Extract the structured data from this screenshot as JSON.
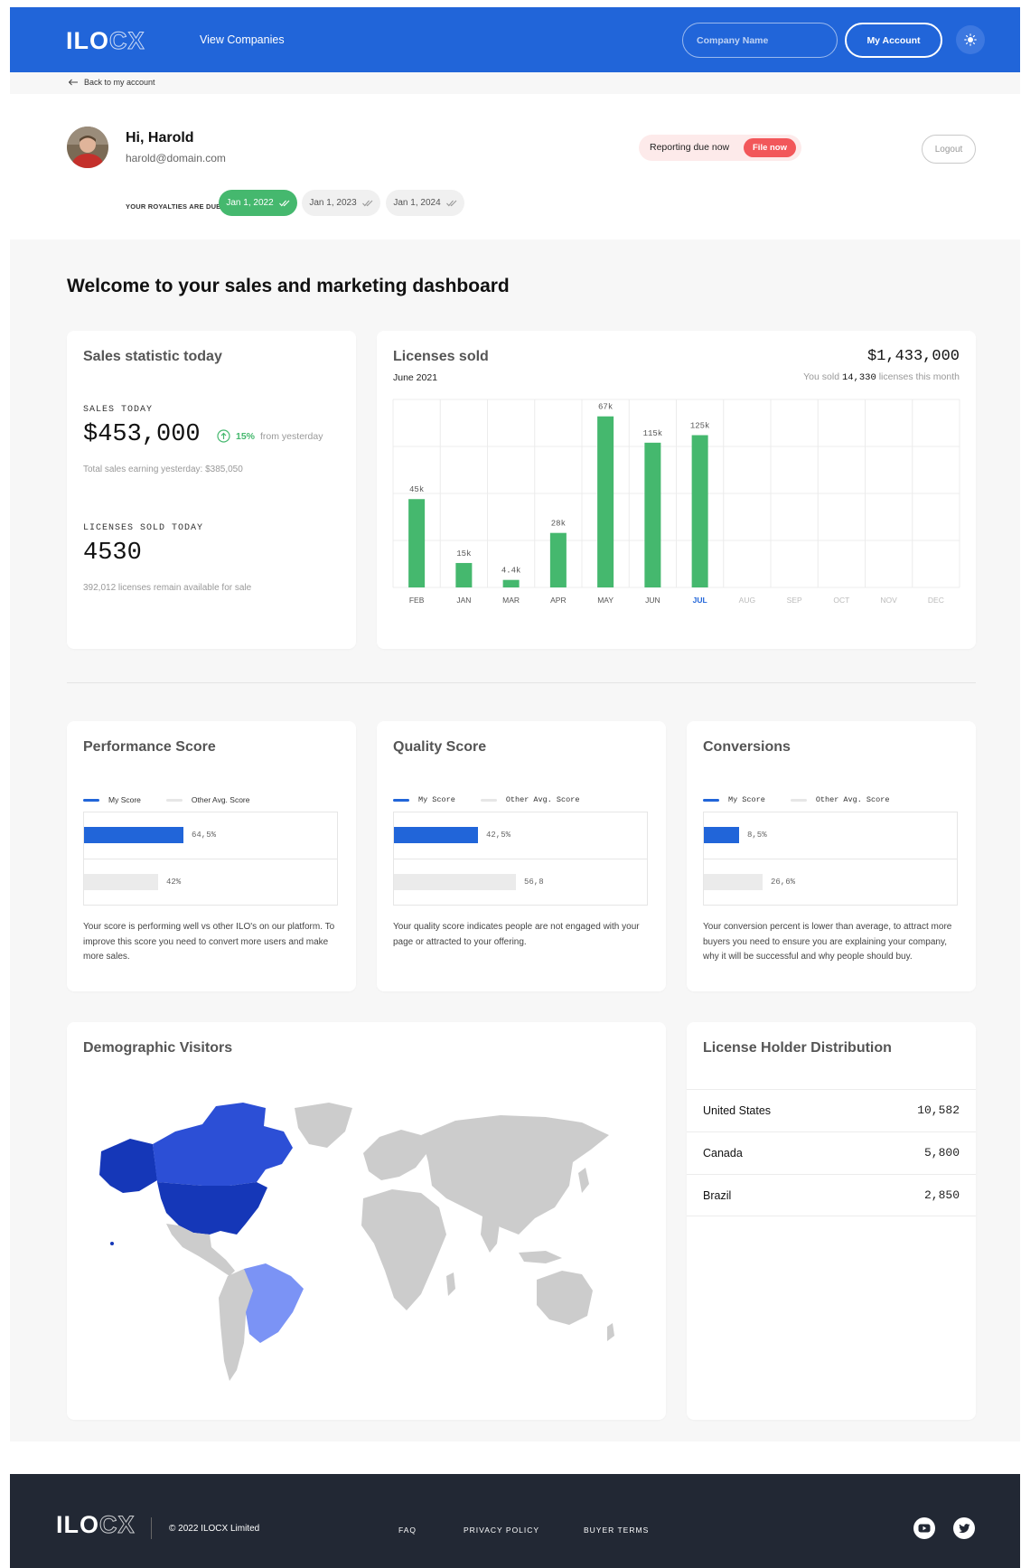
{
  "header": {
    "logo_main": "ILO",
    "logo_outline": "CX",
    "nav_view_companies": "View Companies",
    "company_placeholder": "Company Name",
    "my_account": "My Account"
  },
  "back_link": "Back to my account",
  "profile": {
    "greeting": "Hi, Harold",
    "email": "harold@domain.com"
  },
  "reporting": {
    "text": "Reporting due now",
    "file_button": "File now",
    "logout": "Logout"
  },
  "royalties": {
    "label": "YOUR ROYALTIES ARE DUE",
    "dates": [
      {
        "label": "Jan 1, 2022",
        "active": true
      },
      {
        "label": "Jan 1, 2023",
        "active": false
      },
      {
        "label": "Jan 1, 2024",
        "active": false
      }
    ]
  },
  "page_title": "Welcome to your sales and marketing dashboard",
  "sales_card": {
    "title": "Sales statistic today",
    "sales_label": "SALES TODAY",
    "sales_value": "$453,000",
    "change_pct": "15%",
    "change_text": "from yesterday",
    "yesterday_text": "Total sales earning yesterday: $385,050",
    "licenses_label": "LICENSES SOLD TODAY",
    "licenses_value": "4530",
    "licenses_sub": "392,012 licenses remain available for sale"
  },
  "licenses_card": {
    "title": "Licenses sold",
    "subtitle": "June 2021",
    "total": "$1,433,000",
    "sold_prefix": "You sold",
    "sold_count": "14,330",
    "sold_suffix": "licenses this month"
  },
  "chart_data": {
    "type": "bar",
    "title": "Licenses sold",
    "categories": [
      "FEB",
      "JAN",
      "MAR",
      "APR",
      "MAY",
      "JUN",
      "JUL",
      "AUG",
      "SEP",
      "OCT",
      "NOV",
      "DEC"
    ],
    "values": [
      45,
      15,
      4.4,
      28,
      67,
      115,
      125,
      null,
      null,
      null,
      null,
      null
    ],
    "data_labels": [
      "45k",
      "15k",
      "4.4k",
      "28k",
      "67k",
      "115k",
      "125k",
      "",
      "",
      "",
      "",
      ""
    ],
    "bar_heights_rel": [
      0.47,
      0.13,
      0.04,
      0.29,
      0.91,
      0.77,
      0.81,
      0,
      0,
      0,
      0,
      0
    ],
    "highlight_category": "JUL",
    "grid": true,
    "bar_color": "#45b86e"
  },
  "scores": [
    {
      "title": "Performance Score",
      "legend_my": "My Score",
      "legend_other": "Other Avg. Score",
      "my_value": "64,5%",
      "other_value": "42%",
      "my_frac": 0.39,
      "other_frac": 0.29,
      "description": "Your score is performing well vs other ILO's on our platform. To improve this score you need to convert more users and make more sales."
    },
    {
      "title": "Quality Score",
      "legend_my": "My Score",
      "legend_other": "Other Avg. Score",
      "my_value": "42,5%",
      "other_value": "56,8",
      "my_frac": 0.33,
      "other_frac": 0.48,
      "description": "Your quality score indicates people are not engaged with your page or attracted to your offering."
    },
    {
      "title": "Conversions",
      "legend_my": "My Score",
      "legend_other": "Other Avg. Score",
      "my_value": "8,5%",
      "other_value": "26,6%",
      "my_frac": 0.14,
      "other_frac": 0.23,
      "description": "Your conversion percent is lower than average, to attract more buyers you need to ensure you are explaining your company, why it will be successful and why people should buy."
    }
  ],
  "demographic": {
    "title": "Demographic Visitors",
    "colors": {
      "usa": "#1537b8",
      "canada": "#2c4fd6",
      "brazil": "#7b93f5",
      "other": "#cccccc"
    }
  },
  "license_holders": {
    "title": "License Holder Distribution",
    "rows": [
      {
        "country": "United States",
        "count": "10,582"
      },
      {
        "country": "Canada",
        "count": "5,800"
      },
      {
        "country": "Brazil",
        "count": "2,850"
      }
    ]
  },
  "footer": {
    "copyright": "© 2022 ILOCX Limited",
    "links": [
      "FAQ",
      "PRIVACY POLICY",
      "BUYER TERMS"
    ]
  },
  "colors": {
    "brand_blue": "#2165d9",
    "green": "#45b86e",
    "red": "#f2575a",
    "footer_bg": "#222834"
  }
}
